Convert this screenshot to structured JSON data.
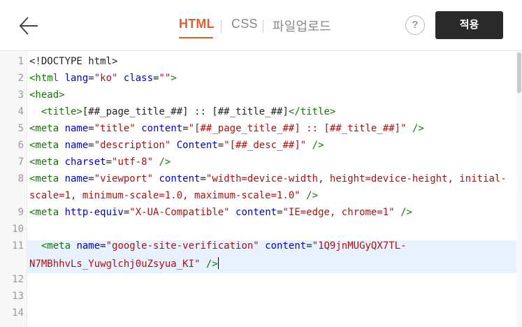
{
  "header": {
    "tabs": [
      {
        "label": "HTML",
        "active": true
      },
      {
        "label": "CSS",
        "active": false
      },
      {
        "label": "파일업로드",
        "active": false
      }
    ],
    "help_label": "?",
    "apply_label": "적용",
    "back_icon": "arrow-left-icon"
  },
  "editor": {
    "lines": [
      {
        "n": "1",
        "tokens": [
          {
            "c": "doc",
            "t": "<!DOCTYPE html>"
          }
        ]
      },
      {
        "n": "2",
        "tokens": [
          {
            "c": "tag",
            "t": "<html "
          },
          {
            "c": "attr",
            "t": "lang"
          },
          {
            "c": "txt",
            "t": "="
          },
          {
            "c": "str",
            "t": "\"ko\""
          },
          {
            "c": "txt",
            "t": " "
          },
          {
            "c": "attr",
            "t": "class"
          },
          {
            "c": "txt",
            "t": "="
          },
          {
            "c": "str",
            "t": "\"\""
          },
          {
            "c": "tag",
            "t": ">"
          }
        ]
      },
      {
        "n": "3",
        "tokens": [
          {
            "c": "tag",
            "t": "<head>"
          }
        ]
      },
      {
        "n": "4",
        "tokens": [
          {
            "c": "txt",
            "t": "  "
          },
          {
            "c": "tag",
            "t": "<title>"
          },
          {
            "c": "txt",
            "t": "[##_page_title_##] :: [##_title_##]"
          },
          {
            "c": "tag",
            "t": "</title>"
          }
        ]
      },
      {
        "n": "5",
        "tokens": [
          {
            "c": "tag",
            "t": "<meta "
          },
          {
            "c": "attr",
            "t": "name"
          },
          {
            "c": "txt",
            "t": "="
          },
          {
            "c": "str",
            "t": "\"title\""
          },
          {
            "c": "txt",
            "t": " "
          },
          {
            "c": "attr",
            "t": "content"
          },
          {
            "c": "txt",
            "t": "="
          },
          {
            "c": "str",
            "t": "\"[##_page_title_##] :: [##_title_##]\""
          },
          {
            "c": "txt",
            "t": " "
          },
          {
            "c": "tag",
            "t": "/>"
          }
        ]
      },
      {
        "n": "6",
        "tokens": [
          {
            "c": "tag",
            "t": "<meta "
          },
          {
            "c": "attr",
            "t": "name"
          },
          {
            "c": "txt",
            "t": "="
          },
          {
            "c": "str",
            "t": "\"description\""
          },
          {
            "c": "txt",
            "t": " "
          },
          {
            "c": "attr",
            "t": "Content"
          },
          {
            "c": "txt",
            "t": "="
          },
          {
            "c": "str",
            "t": "\"[##_desc_##]\""
          },
          {
            "c": "txt",
            "t": " "
          },
          {
            "c": "tag",
            "t": "/>"
          }
        ]
      },
      {
        "n": "7",
        "tokens": [
          {
            "c": "tag",
            "t": "<meta "
          },
          {
            "c": "attr",
            "t": "charset"
          },
          {
            "c": "txt",
            "t": "="
          },
          {
            "c": "str",
            "t": "\"utf-8\""
          },
          {
            "c": "txt",
            "t": " "
          },
          {
            "c": "tag",
            "t": "/>"
          }
        ]
      },
      {
        "n": "8",
        "tokens": [
          {
            "c": "tag",
            "t": "<meta "
          },
          {
            "c": "attr",
            "t": "name"
          },
          {
            "c": "txt",
            "t": "="
          },
          {
            "c": "str",
            "t": "\"viewport\""
          },
          {
            "c": "txt",
            "t": " "
          },
          {
            "c": "attr",
            "t": "content"
          },
          {
            "c": "txt",
            "t": "="
          },
          {
            "c": "str",
            "t": "\"width=device-width, height=device-height, initial-"
          }
        ]
      },
      {
        "n": "",
        "tokens": [
          {
            "c": "str",
            "t": "scale=1, minimum-scale=1.0, maximum-scale=1.0\""
          },
          {
            "c": "txt",
            "t": " "
          },
          {
            "c": "tag",
            "t": "/>"
          }
        ]
      },
      {
        "n": "9",
        "tokens": [
          {
            "c": "tag",
            "t": "<meta "
          },
          {
            "c": "attr",
            "t": "http-equiv"
          },
          {
            "c": "txt",
            "t": "="
          },
          {
            "c": "str",
            "t": "\"X-UA-Compatible\""
          },
          {
            "c": "txt",
            "t": " "
          },
          {
            "c": "attr",
            "t": "content"
          },
          {
            "c": "txt",
            "t": "="
          },
          {
            "c": "str",
            "t": "\"IE=edge, chrome=1\""
          },
          {
            "c": "txt",
            "t": " "
          },
          {
            "c": "tag",
            "t": "/>"
          }
        ]
      },
      {
        "n": "10",
        "tokens": []
      },
      {
        "n": "11",
        "tokens": [
          {
            "c": "txt",
            "t": "  "
          },
          {
            "c": "tag",
            "t": "<meta "
          },
          {
            "c": "attr",
            "t": "name"
          },
          {
            "c": "txt",
            "t": "="
          },
          {
            "c": "str",
            "t": "\"google-site-verification\""
          },
          {
            "c": "txt",
            "t": " "
          },
          {
            "c": "attr",
            "t": "content"
          },
          {
            "c": "txt",
            "t": "="
          },
          {
            "c": "str",
            "t": "\"1Q9jnMUGyQX7TL-"
          }
        ]
      },
      {
        "n": "",
        "tokens": [
          {
            "c": "str",
            "t": "N7MBhhvLs_Yuwglchj0uZsyua_KI\""
          },
          {
            "c": "txt",
            "t": " "
          },
          {
            "c": "tag",
            "t": "/>"
          },
          {
            "c": "cursor",
            "t": ""
          }
        ]
      },
      {
        "n": "12",
        "tokens": []
      },
      {
        "n": "13",
        "tokens": []
      },
      {
        "n": "14",
        "tokens": []
      }
    ]
  },
  "colors": {
    "accent": "#e35d2a",
    "tag": "#117700",
    "attr": "#0000cc",
    "string": "#aa1111",
    "active_line_bg": "#e8f2ff",
    "apply_button_bg": "#2b2b2b"
  }
}
